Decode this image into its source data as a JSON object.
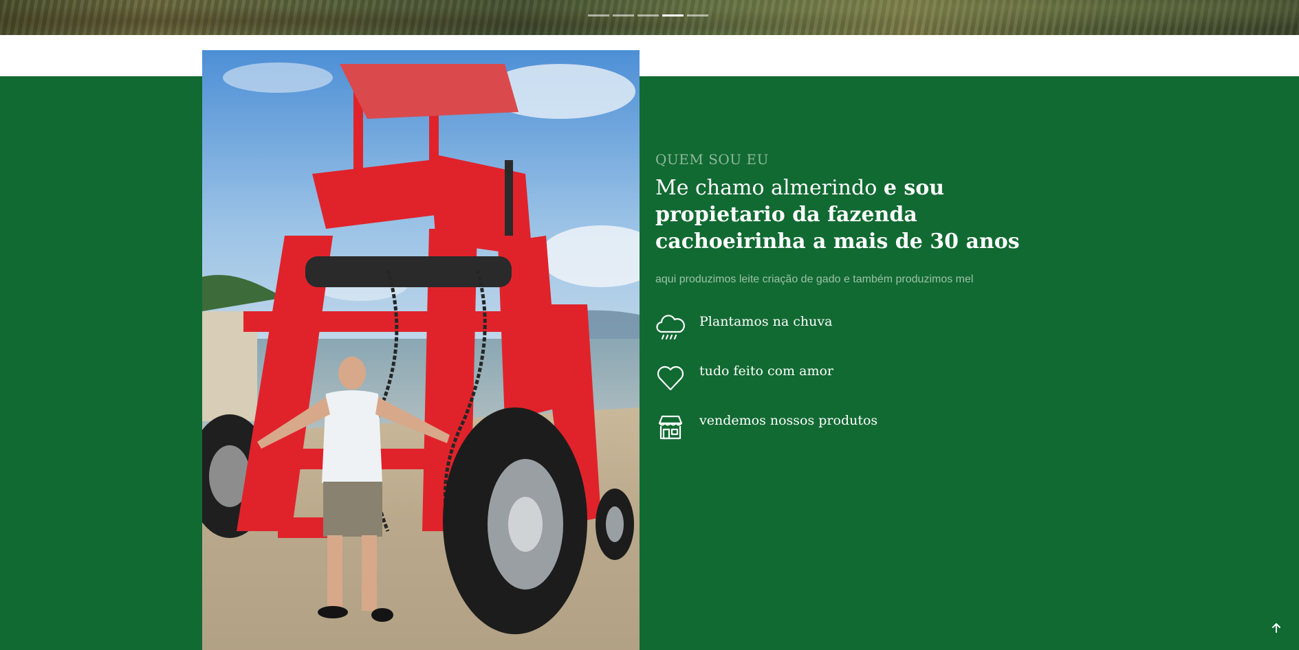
{
  "slider": {
    "count": 5,
    "active_index": 3
  },
  "about": {
    "eyebrow": "QUEM SOU EU",
    "headline_regular": "Me chamo almerindo",
    "headline_bold": "e sou propietario da fazenda cachoeirinha a mais de 30 anos",
    "description": "aqui produzimos leite criação de gado e também produzimos mel",
    "features": [
      {
        "icon": "rain-cloud-icon",
        "label": "Plantamos na chuva"
      },
      {
        "icon": "heart-icon",
        "label": "tudo feito com amor"
      },
      {
        "icon": "store-icon",
        "label": "vendemos nossos produtos"
      }
    ]
  },
  "photo": {
    "icon": "farmer-tractor-photo"
  },
  "back_to_top": {
    "icon": "arrow-up-icon"
  },
  "colors": {
    "brand_green": "#116a32",
    "eyebrow": "#8fb89a",
    "description": "#9cc2a6",
    "white": "#ffffff"
  }
}
